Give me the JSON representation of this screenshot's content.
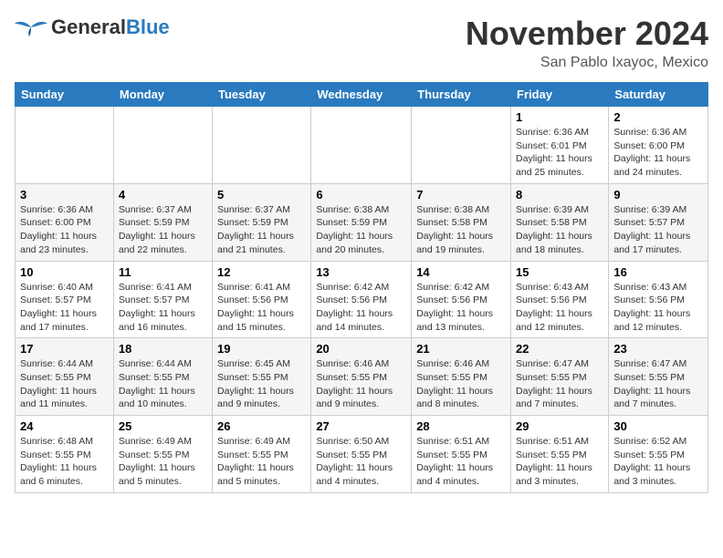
{
  "header": {
    "logo_general": "General",
    "logo_blue": "Blue",
    "month": "November 2024",
    "location": "San Pablo Ixayoc, Mexico"
  },
  "calendar": {
    "days_of_week": [
      "Sunday",
      "Monday",
      "Tuesday",
      "Wednesday",
      "Thursday",
      "Friday",
      "Saturday"
    ],
    "weeks": [
      [
        {
          "day": "",
          "info": ""
        },
        {
          "day": "",
          "info": ""
        },
        {
          "day": "",
          "info": ""
        },
        {
          "day": "",
          "info": ""
        },
        {
          "day": "",
          "info": ""
        },
        {
          "day": "1",
          "info": "Sunrise: 6:36 AM\nSunset: 6:01 PM\nDaylight: 11 hours\nand 25 minutes."
        },
        {
          "day": "2",
          "info": "Sunrise: 6:36 AM\nSunset: 6:00 PM\nDaylight: 11 hours\nand 24 minutes."
        }
      ],
      [
        {
          "day": "3",
          "info": "Sunrise: 6:36 AM\nSunset: 6:00 PM\nDaylight: 11 hours\nand 23 minutes."
        },
        {
          "day": "4",
          "info": "Sunrise: 6:37 AM\nSunset: 5:59 PM\nDaylight: 11 hours\nand 22 minutes."
        },
        {
          "day": "5",
          "info": "Sunrise: 6:37 AM\nSunset: 5:59 PM\nDaylight: 11 hours\nand 21 minutes."
        },
        {
          "day": "6",
          "info": "Sunrise: 6:38 AM\nSunset: 5:59 PM\nDaylight: 11 hours\nand 20 minutes."
        },
        {
          "day": "7",
          "info": "Sunrise: 6:38 AM\nSunset: 5:58 PM\nDaylight: 11 hours\nand 19 minutes."
        },
        {
          "day": "8",
          "info": "Sunrise: 6:39 AM\nSunset: 5:58 PM\nDaylight: 11 hours\nand 18 minutes."
        },
        {
          "day": "9",
          "info": "Sunrise: 6:39 AM\nSunset: 5:57 PM\nDaylight: 11 hours\nand 17 minutes."
        }
      ],
      [
        {
          "day": "10",
          "info": "Sunrise: 6:40 AM\nSunset: 5:57 PM\nDaylight: 11 hours\nand 17 minutes."
        },
        {
          "day": "11",
          "info": "Sunrise: 6:41 AM\nSunset: 5:57 PM\nDaylight: 11 hours\nand 16 minutes."
        },
        {
          "day": "12",
          "info": "Sunrise: 6:41 AM\nSunset: 5:56 PM\nDaylight: 11 hours\nand 15 minutes."
        },
        {
          "day": "13",
          "info": "Sunrise: 6:42 AM\nSunset: 5:56 PM\nDaylight: 11 hours\nand 14 minutes."
        },
        {
          "day": "14",
          "info": "Sunrise: 6:42 AM\nSunset: 5:56 PM\nDaylight: 11 hours\nand 13 minutes."
        },
        {
          "day": "15",
          "info": "Sunrise: 6:43 AM\nSunset: 5:56 PM\nDaylight: 11 hours\nand 12 minutes."
        },
        {
          "day": "16",
          "info": "Sunrise: 6:43 AM\nSunset: 5:56 PM\nDaylight: 11 hours\nand 12 minutes."
        }
      ],
      [
        {
          "day": "17",
          "info": "Sunrise: 6:44 AM\nSunset: 5:55 PM\nDaylight: 11 hours\nand 11 minutes."
        },
        {
          "day": "18",
          "info": "Sunrise: 6:44 AM\nSunset: 5:55 PM\nDaylight: 11 hours\nand 10 minutes."
        },
        {
          "day": "19",
          "info": "Sunrise: 6:45 AM\nSunset: 5:55 PM\nDaylight: 11 hours\nand 9 minutes."
        },
        {
          "day": "20",
          "info": "Sunrise: 6:46 AM\nSunset: 5:55 PM\nDaylight: 11 hours\nand 9 minutes."
        },
        {
          "day": "21",
          "info": "Sunrise: 6:46 AM\nSunset: 5:55 PM\nDaylight: 11 hours\nand 8 minutes."
        },
        {
          "day": "22",
          "info": "Sunrise: 6:47 AM\nSunset: 5:55 PM\nDaylight: 11 hours\nand 7 minutes."
        },
        {
          "day": "23",
          "info": "Sunrise: 6:47 AM\nSunset: 5:55 PM\nDaylight: 11 hours\nand 7 minutes."
        }
      ],
      [
        {
          "day": "24",
          "info": "Sunrise: 6:48 AM\nSunset: 5:55 PM\nDaylight: 11 hours\nand 6 minutes."
        },
        {
          "day": "25",
          "info": "Sunrise: 6:49 AM\nSunset: 5:55 PM\nDaylight: 11 hours\nand 5 minutes."
        },
        {
          "day": "26",
          "info": "Sunrise: 6:49 AM\nSunset: 5:55 PM\nDaylight: 11 hours\nand 5 minutes."
        },
        {
          "day": "27",
          "info": "Sunrise: 6:50 AM\nSunset: 5:55 PM\nDaylight: 11 hours\nand 4 minutes."
        },
        {
          "day": "28",
          "info": "Sunrise: 6:51 AM\nSunset: 5:55 PM\nDaylight: 11 hours\nand 4 minutes."
        },
        {
          "day": "29",
          "info": "Sunrise: 6:51 AM\nSunset: 5:55 PM\nDaylight: 11 hours\nand 3 minutes."
        },
        {
          "day": "30",
          "info": "Sunrise: 6:52 AM\nSunset: 5:55 PM\nDaylight: 11 hours\nand 3 minutes."
        }
      ]
    ]
  }
}
